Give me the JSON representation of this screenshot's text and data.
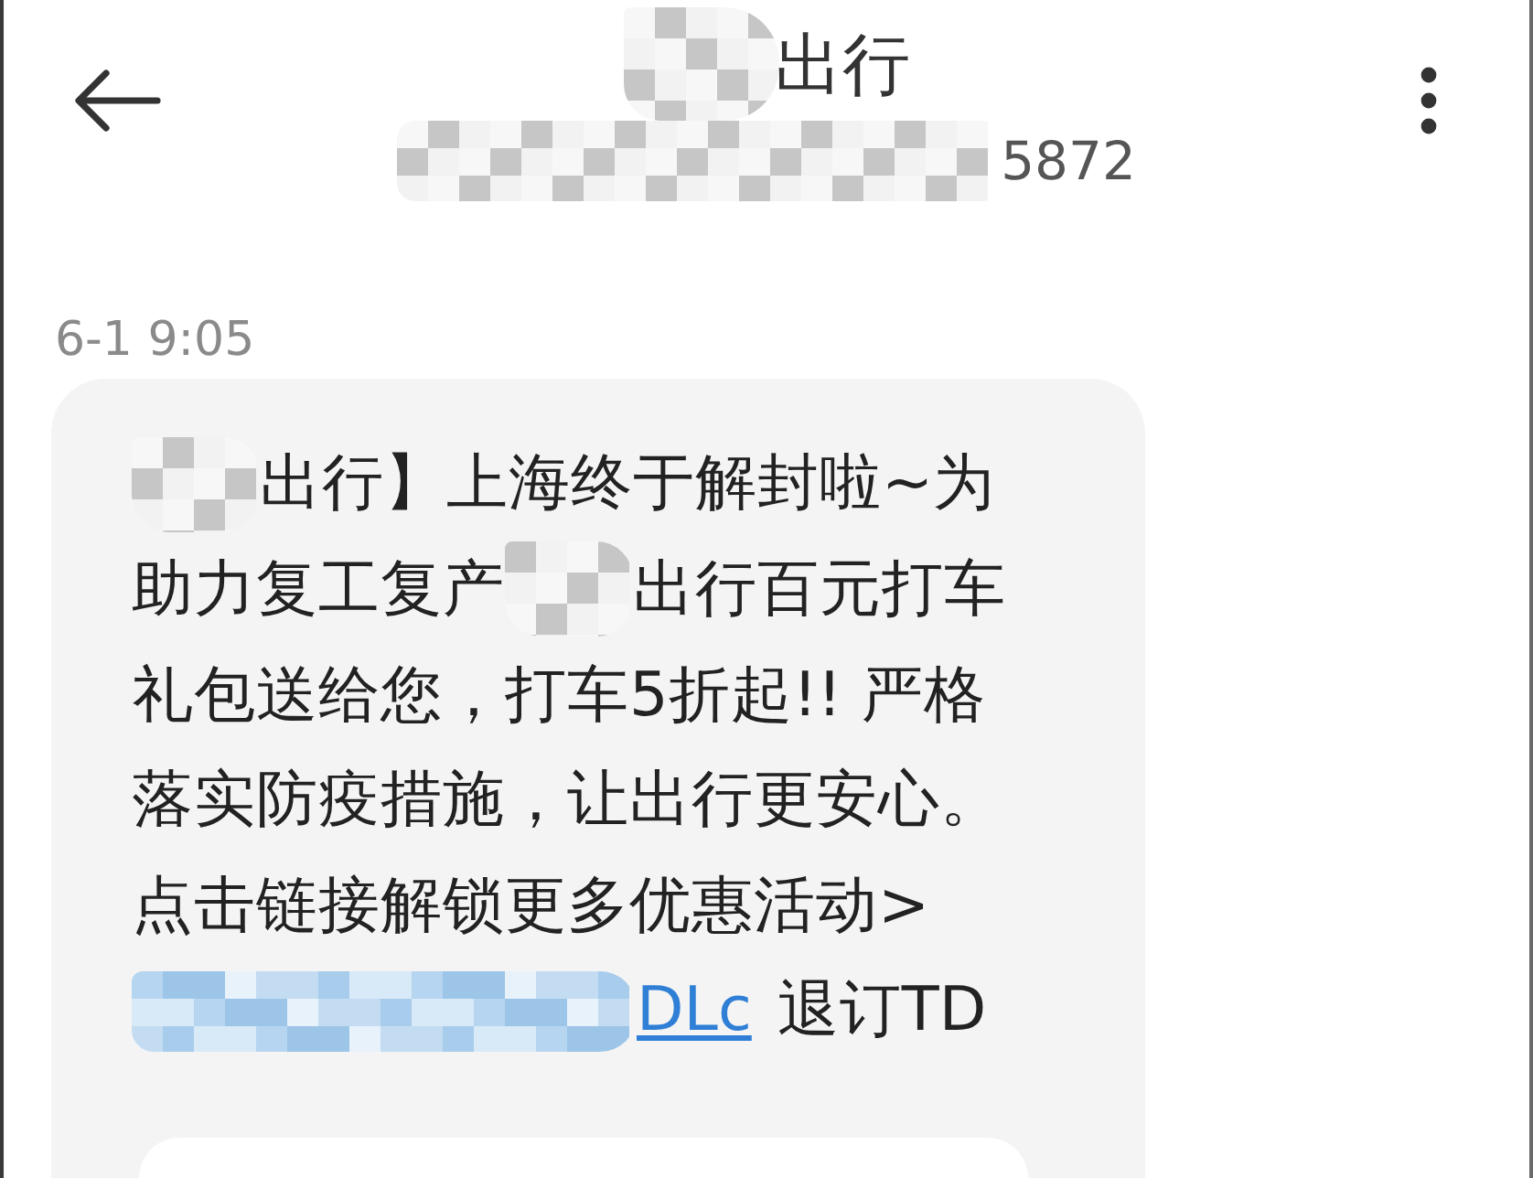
{
  "header": {
    "title": {
      "redacted": true,
      "text": "出行"
    },
    "subtitle": {
      "redacted": true,
      "text": "5872"
    }
  },
  "messages": [
    {
      "time": "6-1 9:05",
      "card": true,
      "lines": [
        [
          {
            "kind": "redacted"
          },
          {
            "kind": "text",
            "text": "出行】上海终于解封啦~为"
          }
        ],
        [
          {
            "kind": "text",
            "text": "助力复工复产"
          },
          {
            "kind": "redacted"
          },
          {
            "kind": "text",
            "text": "出行百元打车"
          }
        ],
        [
          {
            "kind": "text",
            "text": "礼包送给您，打车5折起!! 严格"
          }
        ],
        [
          {
            "kind": "text",
            "text": "落实防疫措施，让出行更安心。"
          }
        ],
        [
          {
            "kind": "text",
            "text": "点击链接解锁更多优惠活动>"
          }
        ],
        [
          {
            "kind": "redacted_link"
          },
          {
            "kind": "link",
            "text": "DLc"
          },
          {
            "kind": "text",
            "text": "退订TD"
          }
        ]
      ]
    }
  ]
}
